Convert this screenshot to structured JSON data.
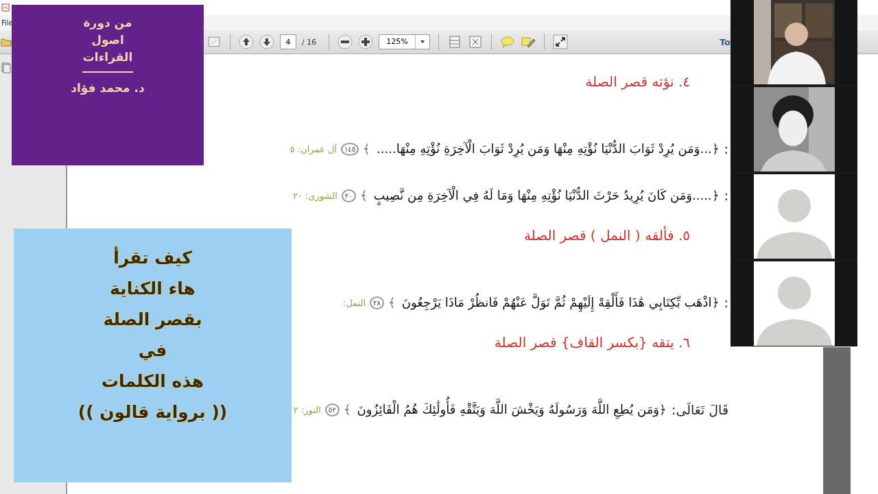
{
  "menu": [
    "File"
  ],
  "toolbar": {
    "page": "4",
    "page_count": "/ 16",
    "zoom": "125%",
    "tools_label": "To"
  },
  "document": {
    "blocks": [
      {
        "kind": "heading",
        "text": "٤. نؤته قصر الصلة"
      },
      {
        "kind": "verse",
        "prefix": ":",
        "text": "﴿...وَمَن يُرِدْ ثَوَابَ الدُّنْيَا نُؤْتِهِ مِنْهَا وَمَن يُرِدْ ثَوَابَ الْآخِرَةِ نُؤْتِهِ مِنْهَا.....",
        "closing": "﴾",
        "number": "١٤٥",
        "reference": "آل عمران: ٥"
      },
      {
        "kind": "verse",
        "prefix": ":",
        "text": "﴿.....وَمَن كَانَ يُرِيدُ حَرْثَ الدُّنْيَا نُؤْتِهِ مِنْهَا وَمَا لَهُ فِي الْآخِرَةِ مِن نَّصِيبٍ",
        "closing": "﴾",
        "number": "٢٠",
        "reference": "الشورى: ٢٠"
      },
      {
        "kind": "heading",
        "text": "٥. فألقه ( النمل ) قصر الصلة"
      },
      {
        "kind": "verse",
        "prefix": ":",
        "text": "﴿اذْهَب بِّكِتَابِي هَٰذَا فَأَلْقِهْ إِلَيْهِمْ ثُمَّ تَوَلَّ عَنْهُمْ فَانظُرْ مَاذَا يَرْجِعُونَ",
        "closing": "﴾",
        "number": "٢٨",
        "reference": "النمل:"
      },
      {
        "kind": "heading",
        "text": "٦. يتقه {بكسر القاف} قصر الصلة"
      },
      {
        "kind": "verse",
        "prefix": "قَالَ تَعَالَى:",
        "text": "﴿وَمَن يُطِعِ اللَّهَ وَرَسُولَهُ وَيَخْشَ اللَّهَ وَيَتَّقْهِ فَأُولَٰئِكَ هُمُ الْفَائِزُونَ",
        "closing": "﴾",
        "number": "٥٢",
        "reference": "النور: ٢"
      }
    ]
  },
  "title_card": {
    "lines": [
      "من دورة",
      "اصول",
      "القراءات"
    ],
    "author": "د. محمد فؤاد"
  },
  "lesson_card": {
    "lines": [
      "كيف تقرأ",
      "هاء الكناية",
      "بقصر الصلة",
      "في",
      "هذه الكلمات",
      "(( برواية قالون ))"
    ]
  },
  "video_tiles": [
    {
      "kind": "picture"
    },
    {
      "kind": "picture"
    },
    {
      "kind": "avatar"
    },
    {
      "kind": "avatar"
    }
  ]
}
